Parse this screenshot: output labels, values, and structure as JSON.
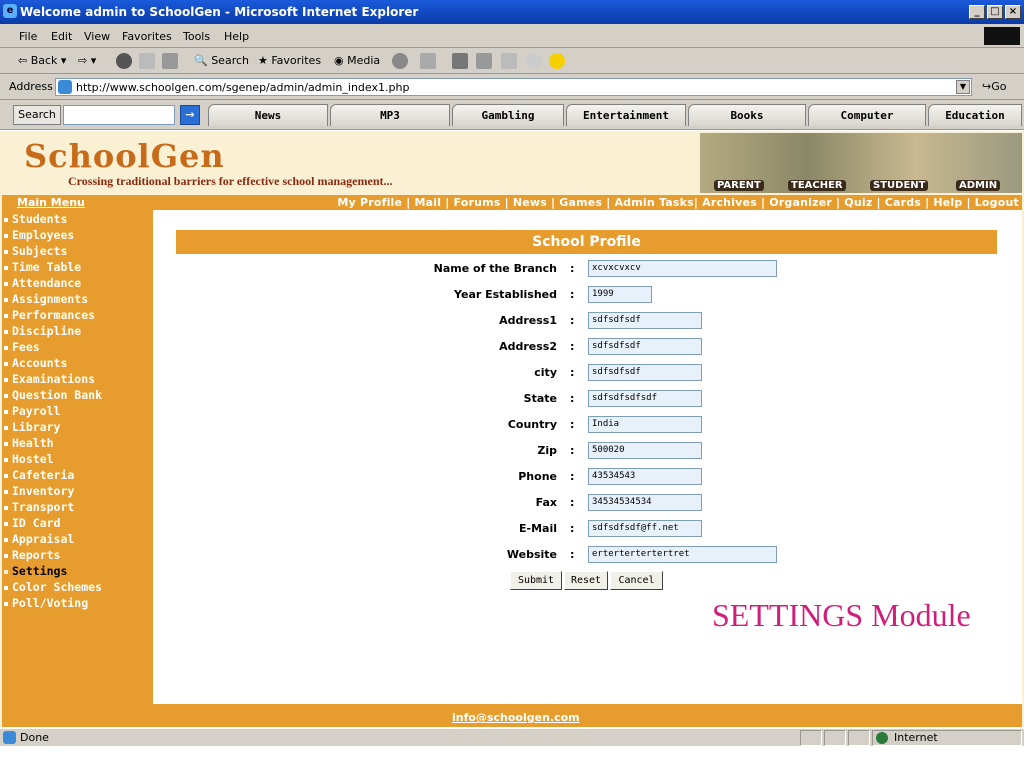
{
  "window": {
    "title": "Welcome admin to SchoolGen - Microsoft Internet Explorer",
    "min": "_",
    "max": "□",
    "close": "×"
  },
  "menu": [
    "File",
    "Edit",
    "View",
    "Favorites",
    "Tools",
    "Help"
  ],
  "toolbar": {
    "back": "Back",
    "search": "Search",
    "favorites": "Favorites",
    "media": "Media"
  },
  "address": {
    "label": "Address",
    "url": "http://www.schoolgen.com/sgenep/admin/admin_index1.php",
    "go": "Go"
  },
  "searchbar": {
    "label": "Search",
    "tabs": [
      "News",
      "MP3",
      "Gambling",
      "Entertainment",
      "Books",
      "Computer",
      "Education"
    ]
  },
  "site": {
    "logo": "SchoolGen",
    "tagline": "Crossing traditional barriers for effective school management...",
    "banner_labels": [
      "PARENT",
      "TEACHER",
      "STUDENT",
      "ADMIN"
    ],
    "main_menu": "Main Menu",
    "top_nav": "My Profile | Mail | Forums | News | Games | Admin Tasks| Archives | Organizer | Quiz | Cards | Help | Logout",
    "footer_email": "info@schoolgen.com"
  },
  "sidebar": [
    "Students",
    "Employees",
    "Subjects",
    "Time Table",
    "Attendance",
    "Assignments",
    "Performances",
    "Discipline",
    "Fees",
    "Accounts",
    "Examinations",
    "Question Bank",
    "Payroll",
    "Library",
    "Health",
    "Hostel",
    "Cafeteria",
    "Inventory",
    "Transport",
    "ID Card",
    "Appraisal",
    "Reports",
    "Settings",
    "Color Schemes",
    "Poll/Voting"
  ],
  "form": {
    "title": "School Profile",
    "fields": [
      {
        "label": "Name of the Branch",
        "value": "xcvxcvxcv"
      },
      {
        "label": "Year Established",
        "value": "1999"
      },
      {
        "label": "Address1",
        "value": "sdfsdfsdf"
      },
      {
        "label": "Address2",
        "value": "sdfsdfsdf"
      },
      {
        "label": "city",
        "value": "sdfsdfsdf"
      },
      {
        "label": "State",
        "value": "sdfsdfsdfsdf"
      },
      {
        "label": "Country",
        "value": "India"
      },
      {
        "label": "Zip",
        "value": "500020"
      },
      {
        "label": "Phone",
        "value": "43534543"
      },
      {
        "label": "Fax",
        "value": "34534534534"
      },
      {
        "label": "E-Mail",
        "value": "sdfsdfsdf@ff.net"
      },
      {
        "label": "Website",
        "value": "ertertertertertret"
      }
    ],
    "colon": ":",
    "submit": "Submit",
    "reset": "Reset",
    "cancel": "Cancel"
  },
  "module_caption": "SETTINGS Module",
  "status": {
    "text": "Done",
    "zone": "Internet"
  }
}
